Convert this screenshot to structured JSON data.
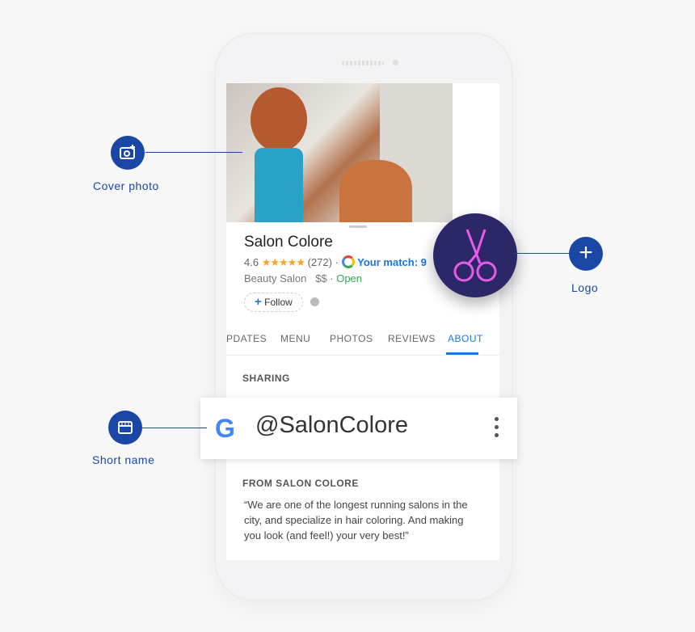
{
  "business": {
    "name": "Salon Colore",
    "rating": "4.6",
    "stars": "★★★★★",
    "reviews": "(272)",
    "match": "Your match: 9",
    "category": "Beauty Salon",
    "price": "$$",
    "status": "Open",
    "follow": "Follow"
  },
  "tabs": [
    "PDATES",
    "MENU",
    "PHOTOS",
    "REVIEWS",
    "ABOUT"
  ],
  "active_tab": "ABOUT",
  "sections": {
    "sharing": "SHARING",
    "from": "FROM SALON COLORE",
    "description": "“We are one of the longest running salons in the city, and specialize in hair coloring. And making you look (and feel!) your very best!”"
  },
  "short_name_bar": {
    "google_logo": "G",
    "name": "@SalonColore"
  },
  "callouts": {
    "cover": "Cover photo",
    "logo": "Logo",
    "short": "Short name"
  },
  "colors": {
    "accent": "#1a73e8",
    "callout": "#1a47a6",
    "logo_bg": "#2c2868",
    "logo_fg": "#e85ae8"
  }
}
